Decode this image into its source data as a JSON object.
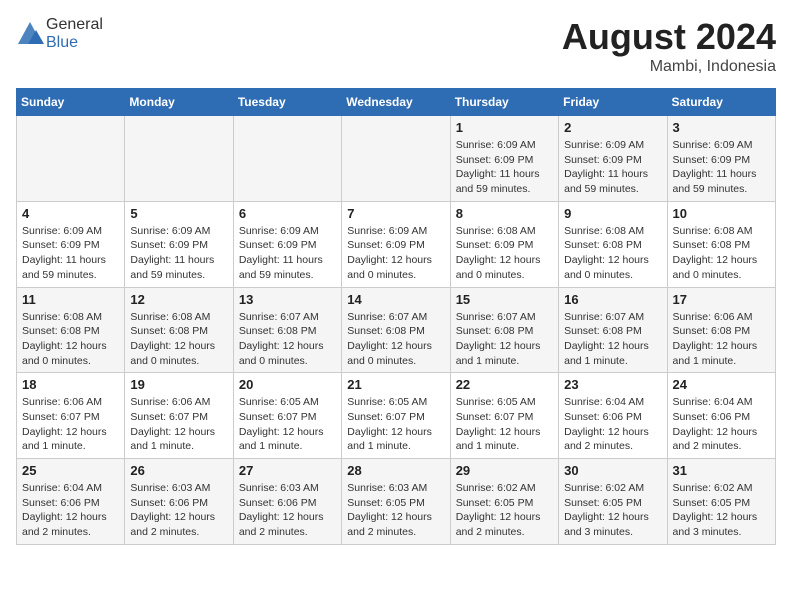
{
  "header": {
    "logo_general": "General",
    "logo_blue": "Blue",
    "title": "August 2024",
    "subtitle": "Mambi, Indonesia"
  },
  "weekdays": [
    "Sunday",
    "Monday",
    "Tuesday",
    "Wednesday",
    "Thursday",
    "Friday",
    "Saturday"
  ],
  "weeks": [
    [
      {
        "day": "",
        "info": ""
      },
      {
        "day": "",
        "info": ""
      },
      {
        "day": "",
        "info": ""
      },
      {
        "day": "",
        "info": ""
      },
      {
        "day": "1",
        "info": "Sunrise: 6:09 AM\nSunset: 6:09 PM\nDaylight: 11 hours and 59 minutes."
      },
      {
        "day": "2",
        "info": "Sunrise: 6:09 AM\nSunset: 6:09 PM\nDaylight: 11 hours and 59 minutes."
      },
      {
        "day": "3",
        "info": "Sunrise: 6:09 AM\nSunset: 6:09 PM\nDaylight: 11 hours and 59 minutes."
      }
    ],
    [
      {
        "day": "4",
        "info": "Sunrise: 6:09 AM\nSunset: 6:09 PM\nDaylight: 11 hours and 59 minutes."
      },
      {
        "day": "5",
        "info": "Sunrise: 6:09 AM\nSunset: 6:09 PM\nDaylight: 11 hours and 59 minutes."
      },
      {
        "day": "6",
        "info": "Sunrise: 6:09 AM\nSunset: 6:09 PM\nDaylight: 11 hours and 59 minutes."
      },
      {
        "day": "7",
        "info": "Sunrise: 6:09 AM\nSunset: 6:09 PM\nDaylight: 12 hours and 0 minutes."
      },
      {
        "day": "8",
        "info": "Sunrise: 6:08 AM\nSunset: 6:09 PM\nDaylight: 12 hours and 0 minutes."
      },
      {
        "day": "9",
        "info": "Sunrise: 6:08 AM\nSunset: 6:08 PM\nDaylight: 12 hours and 0 minutes."
      },
      {
        "day": "10",
        "info": "Sunrise: 6:08 AM\nSunset: 6:08 PM\nDaylight: 12 hours and 0 minutes."
      }
    ],
    [
      {
        "day": "11",
        "info": "Sunrise: 6:08 AM\nSunset: 6:08 PM\nDaylight: 12 hours and 0 minutes."
      },
      {
        "day": "12",
        "info": "Sunrise: 6:08 AM\nSunset: 6:08 PM\nDaylight: 12 hours and 0 minutes."
      },
      {
        "day": "13",
        "info": "Sunrise: 6:07 AM\nSunset: 6:08 PM\nDaylight: 12 hours and 0 minutes."
      },
      {
        "day": "14",
        "info": "Sunrise: 6:07 AM\nSunset: 6:08 PM\nDaylight: 12 hours and 0 minutes."
      },
      {
        "day": "15",
        "info": "Sunrise: 6:07 AM\nSunset: 6:08 PM\nDaylight: 12 hours and 1 minute."
      },
      {
        "day": "16",
        "info": "Sunrise: 6:07 AM\nSunset: 6:08 PM\nDaylight: 12 hours and 1 minute."
      },
      {
        "day": "17",
        "info": "Sunrise: 6:06 AM\nSunset: 6:08 PM\nDaylight: 12 hours and 1 minute."
      }
    ],
    [
      {
        "day": "18",
        "info": "Sunrise: 6:06 AM\nSunset: 6:07 PM\nDaylight: 12 hours and 1 minute."
      },
      {
        "day": "19",
        "info": "Sunrise: 6:06 AM\nSunset: 6:07 PM\nDaylight: 12 hours and 1 minute."
      },
      {
        "day": "20",
        "info": "Sunrise: 6:05 AM\nSunset: 6:07 PM\nDaylight: 12 hours and 1 minute."
      },
      {
        "day": "21",
        "info": "Sunrise: 6:05 AM\nSunset: 6:07 PM\nDaylight: 12 hours and 1 minute."
      },
      {
        "day": "22",
        "info": "Sunrise: 6:05 AM\nSunset: 6:07 PM\nDaylight: 12 hours and 1 minute."
      },
      {
        "day": "23",
        "info": "Sunrise: 6:04 AM\nSunset: 6:06 PM\nDaylight: 12 hours and 2 minutes."
      },
      {
        "day": "24",
        "info": "Sunrise: 6:04 AM\nSunset: 6:06 PM\nDaylight: 12 hours and 2 minutes."
      }
    ],
    [
      {
        "day": "25",
        "info": "Sunrise: 6:04 AM\nSunset: 6:06 PM\nDaylight: 12 hours and 2 minutes."
      },
      {
        "day": "26",
        "info": "Sunrise: 6:03 AM\nSunset: 6:06 PM\nDaylight: 12 hours and 2 minutes."
      },
      {
        "day": "27",
        "info": "Sunrise: 6:03 AM\nSunset: 6:06 PM\nDaylight: 12 hours and 2 minutes."
      },
      {
        "day": "28",
        "info": "Sunrise: 6:03 AM\nSunset: 6:05 PM\nDaylight: 12 hours and 2 minutes."
      },
      {
        "day": "29",
        "info": "Sunrise: 6:02 AM\nSunset: 6:05 PM\nDaylight: 12 hours and 2 minutes."
      },
      {
        "day": "30",
        "info": "Sunrise: 6:02 AM\nSunset: 6:05 PM\nDaylight: 12 hours and 3 minutes."
      },
      {
        "day": "31",
        "info": "Sunrise: 6:02 AM\nSunset: 6:05 PM\nDaylight: 12 hours and 3 minutes."
      }
    ]
  ]
}
